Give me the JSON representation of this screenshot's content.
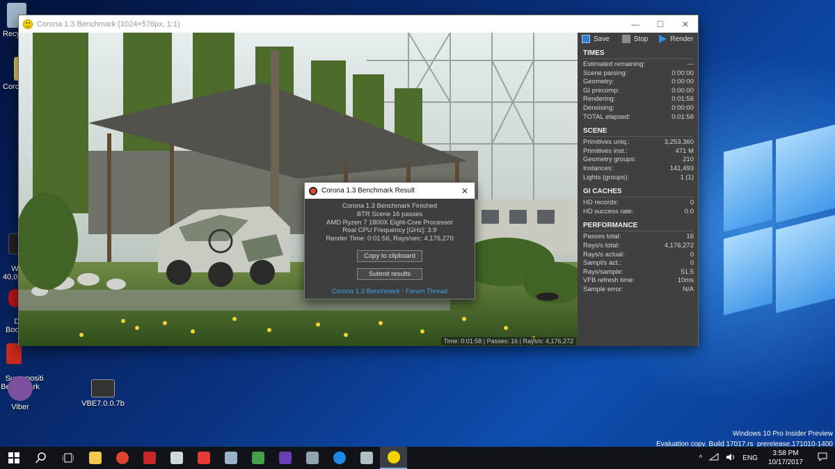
{
  "desktop": {
    "icons": [
      {
        "label": "Recyc",
        "color": "#9fb8cc"
      },
      {
        "label": "Coron",
        "color": "#e7c96a"
      },
      {
        "label": "Warha\n40,00",
        "color": "#222222"
      },
      {
        "label": "Dr\nBoo",
        "color": "#c0141a"
      },
      {
        "label": "Superpositi\nBenchmark",
        "color": "#cc2a1e"
      },
      {
        "label": "Viber",
        "color": "#7b519d"
      },
      {
        "label": "VBE7.0.0.7b",
        "color": "#333333"
      }
    ],
    "watermark": {
      "line1": "Windows 10 Pro Insider Preview",
      "line2": "Evaluation copy. Build 17017.rs_prerelease.171010-1400"
    }
  },
  "vfb": {
    "title": "Corona 1.3 Benchmark (1024×576px, 1:1)",
    "controls": {
      "minimize": "—",
      "maximize": "☐",
      "close": "✕"
    },
    "toolbar": {
      "save": "Save",
      "stop": "Stop",
      "render": "Render"
    },
    "status": "Time: 0:01:58 | Passes: 16 | Rays/s: 4,176,272",
    "sections": {
      "times": {
        "title": "TIMES",
        "rows": [
          {
            "k": "Estimated remaining:",
            "v": "---"
          },
          {
            "k": "Scene parsing:",
            "v": "0:00:00"
          },
          {
            "k": "Geometry:",
            "v": "0:00:00"
          },
          {
            "k": "GI precomp:",
            "v": "0:00:00"
          },
          {
            "k": "Rendering:",
            "v": "0:01:56"
          },
          {
            "k": "Denoising:",
            "v": "0:00:00"
          },
          {
            "k": "TOTAL elapsed:",
            "v": "0:01:58"
          }
        ]
      },
      "scene": {
        "title": "SCENE",
        "rows": [
          {
            "k": "Primitives uniq.:",
            "v": "3,253,360"
          },
          {
            "k": "Primitives inst.:",
            "v": "471 M"
          },
          {
            "k": "Geometry groups:",
            "v": "210"
          },
          {
            "k": "Instances:",
            "v": "141,493"
          },
          {
            "k": "Lights (groups):",
            "v": "1 (1)"
          }
        ]
      },
      "gi": {
        "title": "GI CACHES",
        "rows": [
          {
            "k": "HD records:",
            "v": "0"
          },
          {
            "k": "HD success rate:",
            "v": "0.0"
          }
        ]
      },
      "perf": {
        "title": "PERFORMANCE",
        "rows": [
          {
            "k": "Passes total:",
            "v": "16"
          },
          {
            "k": "Rays/s total:",
            "v": "4,176,272"
          },
          {
            "k": "Rays/s actual:",
            "v": "0"
          },
          {
            "k": "Sampl/s act.:",
            "v": "0"
          },
          {
            "k": "Rays/sample:",
            "v": "51.5"
          },
          {
            "k": "VFB refresh time:",
            "v": "10ms"
          },
          {
            "k": "Sample error:",
            "v": "N/A"
          }
        ]
      }
    }
  },
  "dialog": {
    "title": "Corona 1.3 Benchmark Result",
    "close": "✕",
    "lines": [
      "Corona 1.3 Benchmark Finished",
      "BTR Scene 16 passes",
      "AMD Ryzen 7 1800X Eight-Core Processor",
      "Real CPU Frequency [GHz]: 3.9",
      "Render Time: 0:01:56, Rays/sec: 4,176,270"
    ],
    "copy_button": "Copy to clipboard",
    "submit_button": "Submit results",
    "forum_link": "Corona 1.3 Benchmark - Forum Thread"
  },
  "taskbar": {
    "apps": [
      {
        "name": "start",
        "color": "#ffffff"
      },
      {
        "name": "search",
        "color": "#ffffff"
      },
      {
        "name": "task-view",
        "color": "#ffffff"
      },
      {
        "name": "file-explorer",
        "color": "#f2c94c"
      },
      {
        "name": "chrome",
        "color": "#e0442f"
      },
      {
        "name": "app-red",
        "color": "#c62828"
      },
      {
        "name": "app-tools",
        "color": "#cfd8dc"
      },
      {
        "name": "app-popcorn",
        "color": "#e53935"
      },
      {
        "name": "steam",
        "color": "#9ab3cc"
      },
      {
        "name": "app-green",
        "color": "#43a047"
      },
      {
        "name": "app-purple",
        "color": "#6a3fb5"
      },
      {
        "name": "app-monitor",
        "color": "#90a4ae"
      },
      {
        "name": "app-sphere",
        "color": "#1e88e5"
      },
      {
        "name": "app-window",
        "color": "#b0bec5"
      },
      {
        "name": "corona",
        "color": "#f7d400"
      }
    ],
    "tray": {
      "chevron": "^",
      "lang": "ENG",
      "time": "3:58 PM",
      "date": "10/17/2017",
      "notif": "🗨"
    }
  }
}
